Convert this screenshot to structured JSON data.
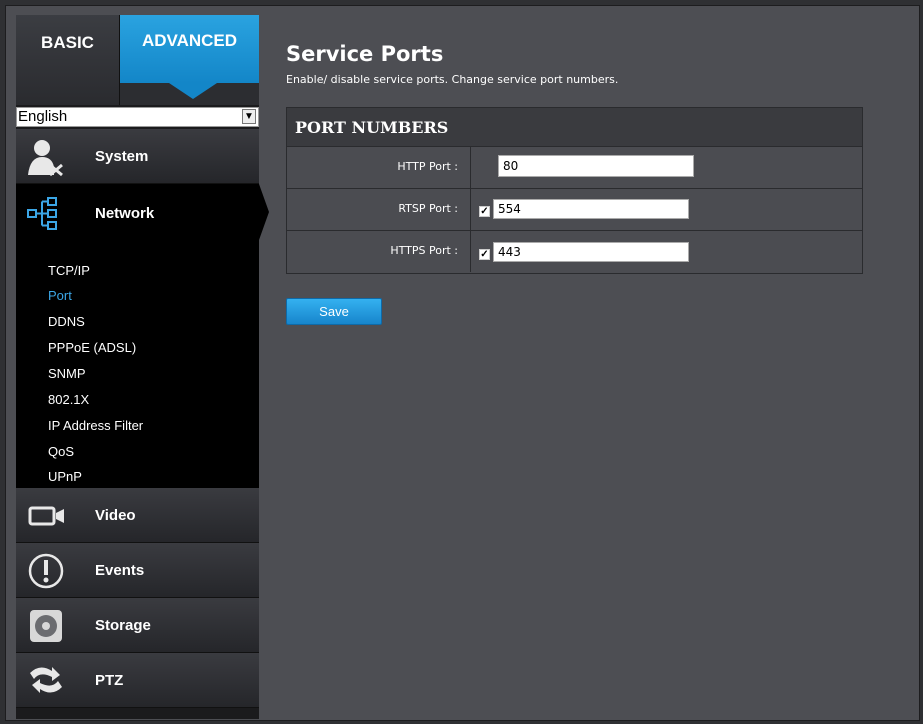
{
  "tabs": {
    "basic": "BASIC",
    "advanced": "ADVANCED"
  },
  "language": {
    "selected": "English"
  },
  "menu": {
    "system": "System",
    "network": "Network",
    "video": "Video",
    "events": "Events",
    "storage": "Storage",
    "ptz": "PTZ"
  },
  "submenu": [
    "TCP/IP",
    "Port",
    "DDNS",
    "PPPoE (ADSL)",
    "SNMP",
    "802.1X",
    "IP Address Filter",
    "QoS",
    "UPnP"
  ],
  "page": {
    "title": "Service Ports",
    "subtitle": "Enable/ disable service ports. Change service port numbers."
  },
  "panel": {
    "heading": "PORT NUMBERS",
    "rows": [
      {
        "label": "HTTP Port :",
        "value": "80",
        "checkbox": false
      },
      {
        "label": "RTSP Port :",
        "value": "554",
        "checkbox": true
      },
      {
        "label": "HTTPS Port :",
        "value": "443",
        "checkbox": true
      }
    ]
  },
  "save_label": "Save",
  "colors": {
    "accent": "#1e96dc",
    "active_link": "#3ba6e6"
  }
}
